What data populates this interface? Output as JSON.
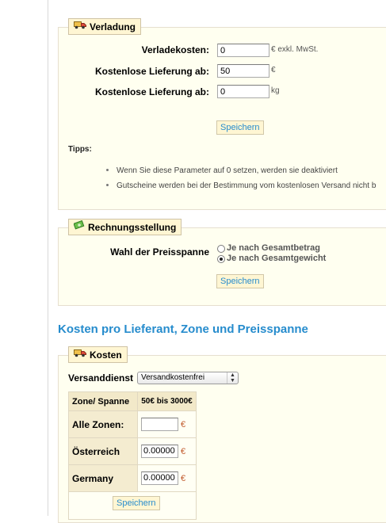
{
  "verladung": {
    "legend": "Verladung",
    "fields": [
      {
        "label": "Verladekosten:",
        "value": "0",
        "unit": "€ exkl. MwSt."
      },
      {
        "label": "Kostenlose Lieferung ab:",
        "value": "50",
        "unit": "€"
      },
      {
        "label": "Kostenlose Lieferung ab:",
        "value": "0",
        "unit": "kg"
      }
    ],
    "save": "Speichern",
    "tips_label": "Tipps:",
    "tips": [
      "Wenn Sie diese Parameter auf 0 setzen, werden sie deaktiviert",
      "Gutscheine werden bei der Bestimmung vom kostenlosen Versand nicht b"
    ]
  },
  "rechnung": {
    "legend": "Rechnungsstellung",
    "label": "Wahl der Preisspanne",
    "options": [
      "Je nach Gesamtbetrag",
      "Je nach Gesamtgewicht"
    ],
    "selected_index": 1,
    "save": "Speichern"
  },
  "kosten_section": {
    "heading": "Kosten pro Lieferant, Zone und Preisspanne",
    "legend": "Kosten",
    "carrier_label": "Versanddienst",
    "carrier_value": "Versandkostenfrei",
    "table": {
      "header": [
        "Zone/ Spanne",
        "50€ bis 3000€"
      ],
      "rows": [
        {
          "zone": "Alle Zonen:",
          "value": "",
          "unit": "€"
        },
        {
          "zone": "Österreich",
          "value": "0.00000",
          "unit": "€"
        },
        {
          "zone": "Germany",
          "value": "0.00000",
          "unit": "€"
        }
      ]
    },
    "save": "Speichern"
  },
  "icons": {
    "truck": "truck-icon",
    "money": "money-icon"
  },
  "colors": {
    "accent": "#268ccd",
    "panel_bg": "#fffff0",
    "legend_bg": "#fff6d3",
    "euro": "#c15a2c"
  }
}
